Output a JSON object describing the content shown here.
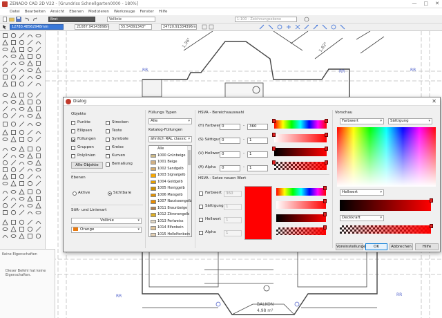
{
  "app": {
    "title": "ZENADO CAD 2D V22 - [Grundriss Schnellgarten0000 - 180%]",
    "menu": [
      "Datei",
      "Bearbeiten",
      "Ansicht",
      "Ebenen",
      "Modizieren",
      "Werkzeuge",
      "Fenster",
      "Hilfe"
    ],
    "window_buttons": [
      "—",
      "□",
      "✕"
    ]
  },
  "toolbar": {
    "layer_value": "Bret",
    "line_type_value": "Vollinie",
    "layer_select_value": "1:100 - Zeichnungsebene",
    "coord_x": "12783.48562948mm",
    "coord_y": "21087.94143898mm",
    "angle": "55.54391343°",
    "length": "24720.91334396mm"
  },
  "properties_panel": {
    "header": "Keine Eigenschaften",
    "message": "Dieser Befehl hat keine Eigenschaften."
  },
  "canvas": {
    "labels": {
      "dim1": "1,36⁵",
      "dim2": "1,82⁵",
      "rr1": "RR",
      "rr2": "RR",
      "rr3": "RR",
      "rr4": "RR",
      "rr5": "RR",
      "balkon": "BALKON",
      "area": "4,98 m²",
      "num26": "26"
    }
  },
  "dialog": {
    "title": "Dialog",
    "objects": {
      "heading": "Objekte",
      "items": [
        {
          "label": "Punkte",
          "checked": false
        },
        {
          "label": "Strecken",
          "checked": false
        },
        {
          "label": "Ellipsen",
          "checked": false
        },
        {
          "label": "Texte",
          "checked": false
        },
        {
          "label": "Füllungen",
          "checked": true
        },
        {
          "label": "Symbole",
          "checked": false
        },
        {
          "label": "Gruppen",
          "checked": false
        },
        {
          "label": "Kreise",
          "checked": false
        },
        {
          "label": "Polylinien",
          "checked": false
        },
        {
          "label": "Kurven",
          "checked": false
        }
      ],
      "all_button": "Alle Objekte",
      "dimension_label": "Bemaßung"
    },
    "layers": {
      "heading": "Ebenen",
      "option_active": "Aktive",
      "option_visible": "Sichtbare",
      "selected": "Sichtbare"
    },
    "pen": {
      "heading": "Stift- und Linienart",
      "line_value": "Vollinie",
      "color_value": "Orange",
      "color_hex": "#e87a10"
    },
    "fill_types": {
      "heading": "Füllungs Typen",
      "value": "Alle",
      "catalog_heading": "Katalog-Füllungen",
      "catalog_value": "ähnlich RAL classic",
      "items": [
        {
          "name": "Alle",
          "color": ""
        },
        {
          "name": "1000 Grünbeige",
          "color": "#cdba88"
        },
        {
          "name": "1001 Beige",
          "color": "#d0b084"
        },
        {
          "name": "1002 Sandgelb",
          "color": "#d2aa6d"
        },
        {
          "name": "1003 Signalgelb",
          "color": "#f9a800"
        },
        {
          "name": "1004 Goldgelb",
          "color": "#e49e00"
        },
        {
          "name": "1005 Honiggelb",
          "color": "#cb8e00"
        },
        {
          "name": "1006 Maisgelb",
          "color": "#e29000"
        },
        {
          "name": "1007 Narzissengelb",
          "color": "#e88c00"
        },
        {
          "name": "1011 Braunbeige",
          "color": "#af804f"
        },
        {
          "name": "1012 Zitronengelb",
          "color": "#ddaf27"
        },
        {
          "name": "1013 Perlweiss",
          "color": "#e3d9c6"
        },
        {
          "name": "1014 Elfenbein",
          "color": "#ddc49a"
        },
        {
          "name": "1015 Hellelfenbein",
          "color": "#e6d2b5"
        }
      ]
    },
    "hsva_range": {
      "heading": "HSVA - Bereichsauswahl",
      "rows": [
        {
          "label": "(H) Farbwert",
          "min": "0",
          "max": "360"
        },
        {
          "label": "(S) Sättigung",
          "min": "0",
          "max": "1"
        },
        {
          "label": "(V) Hellwert",
          "min": "0",
          "max": "1"
        },
        {
          "label": "(A) Alpha",
          "min": "0",
          "max": "1"
        }
      ],
      "separator": "-"
    },
    "hsva_set": {
      "heading": "HSVA - Setze neuen Wert",
      "rows": [
        {
          "label": "Farbwert",
          "value": "360"
        },
        {
          "label": "Sättigung",
          "value": "1"
        },
        {
          "label": "Hellwert",
          "value": "1"
        },
        {
          "label": "Alpha",
          "value": "1"
        }
      ],
      "preview_color": "#ff0000"
    },
    "preview": {
      "heading": "Vorschau",
      "x_axis": "Farbwert",
      "y_axis": "Sättigung",
      "slider1": "Hellwert",
      "slider2": "Deckkraft"
    },
    "buttons": {
      "defaults": "Voreinstellungen",
      "ok": "OK",
      "cancel": "Abbrechen",
      "help": "Hilfe"
    }
  }
}
